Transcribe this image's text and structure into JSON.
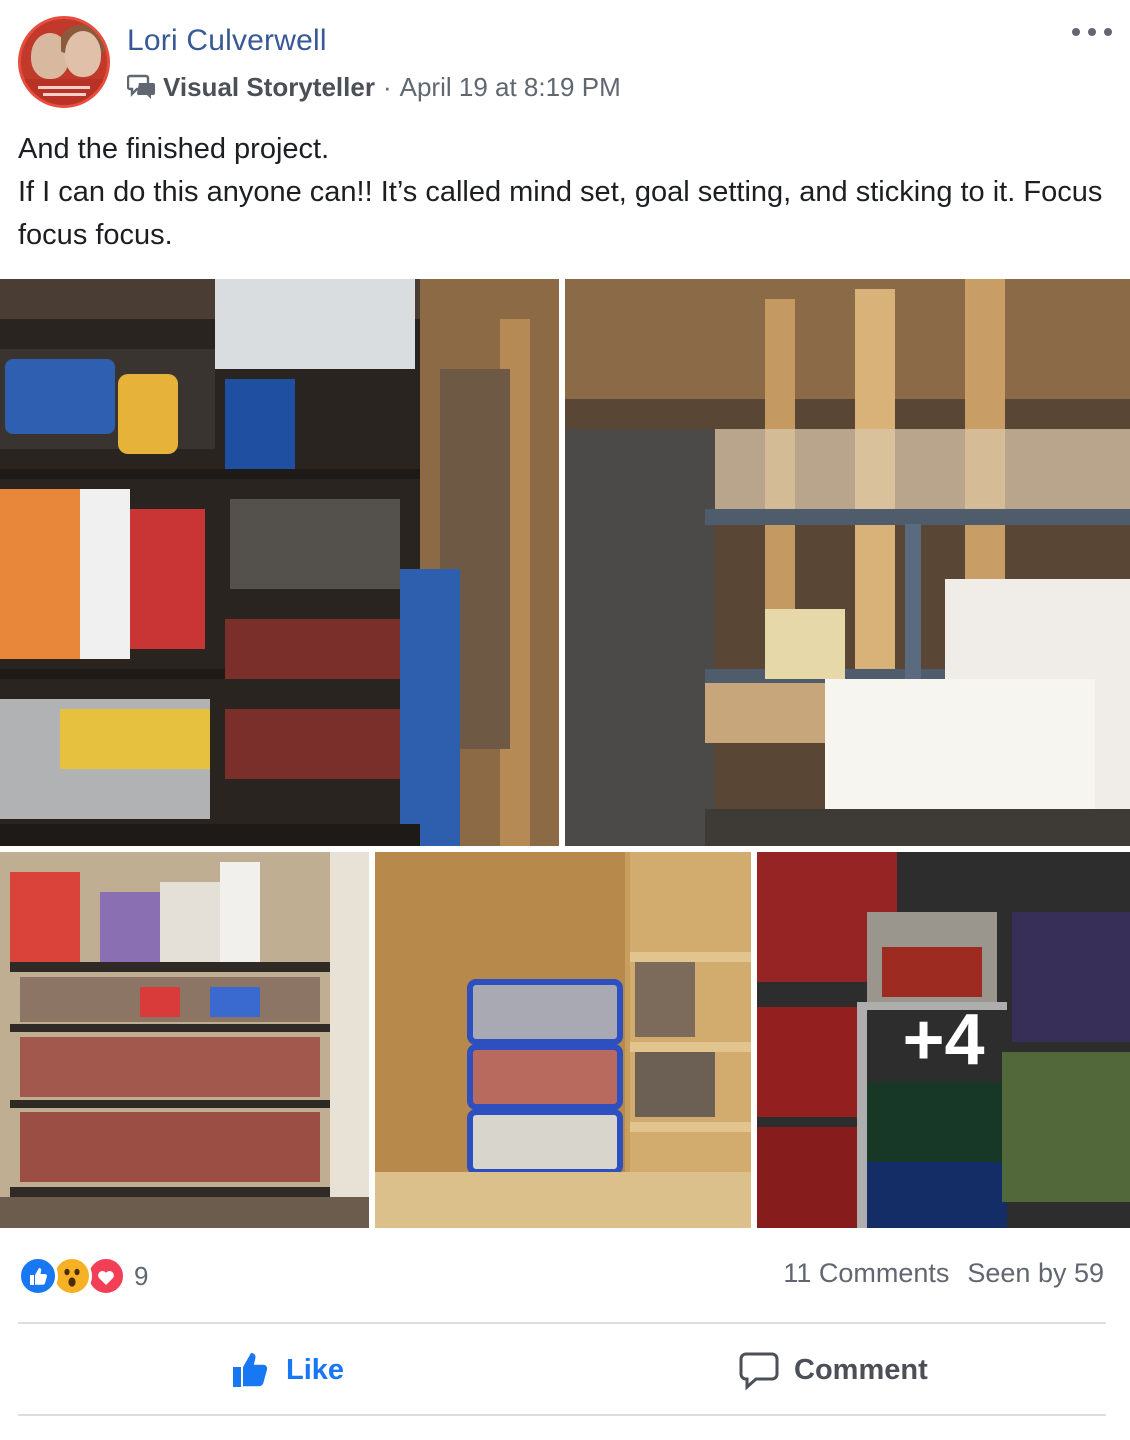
{
  "post": {
    "author_name": "Lori Culverwell",
    "badge_label": "Visual Storyteller",
    "separator": "·",
    "timestamp": "April 19 at 8:19 PM",
    "message_lines": [
      "And the finished project.",
      "If I can do this anyone can!! It’s called mind set, goal setting, and sticking to it. Focus focus focus."
    ],
    "photos": {
      "count": 5,
      "more_overlay": "+4"
    }
  },
  "stats": {
    "reaction_types": [
      "like",
      "wow",
      "love"
    ],
    "reaction_count": "9",
    "comments": "11 Comments",
    "seen_by": "Seen by 59"
  },
  "actions": {
    "like_label": "Like",
    "comment_label": "Comment"
  },
  "colors": {
    "author_link": "#385898",
    "like_blue": "#1877f2",
    "love_red": "#f33e58",
    "wow_yellow": "#f7b125",
    "muted_text": "#606770"
  }
}
